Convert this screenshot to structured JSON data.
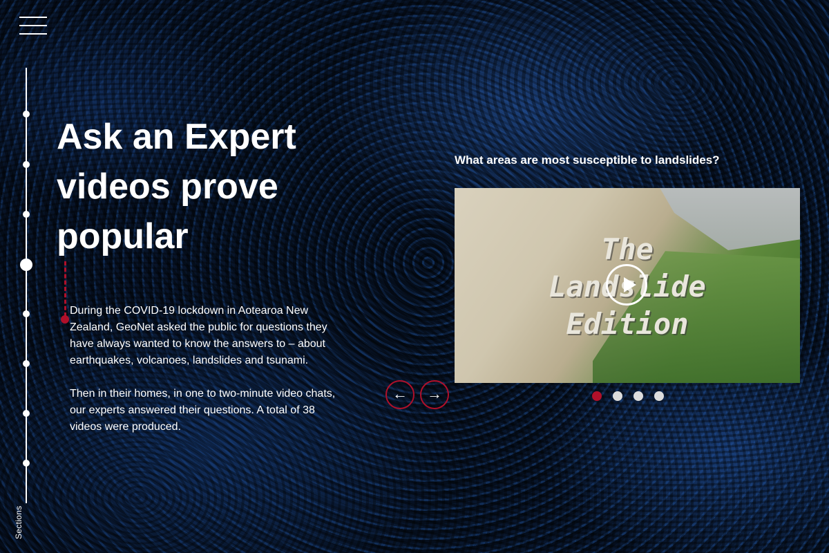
{
  "nav": {
    "sections_label": "Sections"
  },
  "main": {
    "title": "Ask an Expert videos prove popular",
    "paragraphs": [
      "During the COVID-19 lockdown in Aotearoa New Zealand, GeoNet asked the public for questions they have always wanted to know the answers to – about earthquakes, volcanoes, landslides and tsunami.",
      "Then in their homes, in one to two-minute video chats, our experts answered their questions. A total of 38 videos were produced."
    ]
  },
  "video": {
    "question": "What areas are most susceptible to landslides?",
    "title_lines": [
      "The",
      "Landslide",
      "Edition"
    ]
  },
  "carousel": {
    "prev_icon": "←",
    "next_icon": "→"
  },
  "colors": {
    "accent": "#b0102a"
  }
}
